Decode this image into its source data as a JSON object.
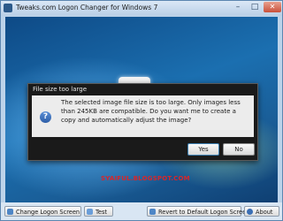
{
  "window": {
    "title": "Tweaks.com Logon Changer for Windows 7",
    "minimize_glyph": "–",
    "maximize_glyph": "□",
    "close_glyph": "✕"
  },
  "dialog": {
    "title": "File size too large",
    "icon": "question-icon",
    "icon_glyph": "?",
    "message": "The selected image file size is too large. Only images less than 245KB are compatible. Do you want me to create a copy and automatically adjust the image?",
    "yes_label": "Yes",
    "no_label": "No"
  },
  "watermark": "SYAIFUL.BLOGSPOT.COM",
  "toolbar": {
    "change_label": "Change Logon Screen",
    "test_label": "Test",
    "revert_label": "Revert to Default Logon Screen",
    "about_label": "About"
  },
  "colors": {
    "accent": "#3c7fb1",
    "watermark": "#d8262a",
    "dialog_frame": "#1a1a1a"
  }
}
